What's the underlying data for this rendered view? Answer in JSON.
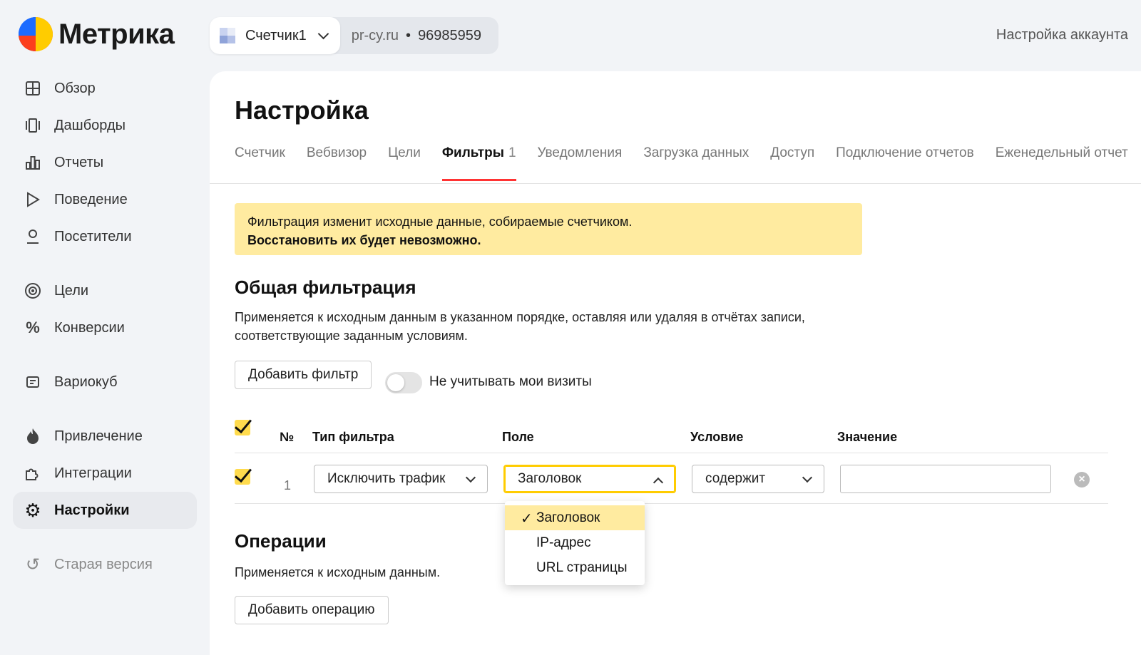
{
  "app": {
    "logo_text": "Метрика",
    "account_link": "Настройка аккаунта"
  },
  "counter": {
    "name": "Счетчик1",
    "site": "pr-cy.ru",
    "separator": "•",
    "id": "96985959"
  },
  "sidebar": {
    "items": [
      {
        "label": "Обзор",
        "icon": "grid-icon"
      },
      {
        "label": "Дашборды",
        "icon": "dashboards-icon"
      },
      {
        "label": "Отчеты",
        "icon": "reports-icon"
      },
      {
        "label": "Поведение",
        "icon": "play-icon"
      },
      {
        "label": "Посетители",
        "icon": "user-icon"
      },
      {
        "label": "Цели",
        "icon": "target-icon"
      },
      {
        "label": "Конверсии",
        "icon": "percent-icon"
      },
      {
        "label": "Вариокуб",
        "icon": "variocube-icon"
      },
      {
        "label": "Привлечение",
        "icon": "flame-icon"
      },
      {
        "label": "Интеграции",
        "icon": "puzzle-icon"
      },
      {
        "label": "Настройки",
        "icon": "gear-icon"
      },
      {
        "label": "Старая версия",
        "icon": "undo-icon"
      }
    ],
    "active": "Настройки"
  },
  "page": {
    "title": "Настройка",
    "tabs": [
      {
        "label": "Счетчик"
      },
      {
        "label": "Вебвизор"
      },
      {
        "label": "Цели"
      },
      {
        "label": "Фильтры",
        "badge": "1"
      },
      {
        "label": "Уведомления"
      },
      {
        "label": "Загрузка данных"
      },
      {
        "label": "Доступ"
      },
      {
        "label": "Подключение отчетов"
      },
      {
        "label": "Еженедельный отчет"
      }
    ],
    "active_tab": "Фильтры"
  },
  "warning": {
    "line1": "Фильтрация изменит исходные данные, собираемые счетчиком.",
    "line2": "Восстановить их будет невозможно."
  },
  "filtering": {
    "title": "Общая фильтрация",
    "description_line1": "Применяется к исходным данным в указанном порядке, оставляя или удаляя в отчётах записи,",
    "description_line2": "соответствующие заданным условиям.",
    "add_button": "Добавить фильтр",
    "toggle_label": "Не учитывать мои визиты",
    "toggle_on": false,
    "columns": [
      "№",
      "Тип фильтра",
      "Поле",
      "Условие",
      "Значение"
    ],
    "rows": [
      {
        "checked": true,
        "num": "1",
        "type": "Исключить трафик",
        "field": "Заголовок",
        "condition": "содержит",
        "value": ""
      }
    ],
    "field_dropdown": {
      "options": [
        "Заголовок",
        "IP-адрес",
        "URL страницы"
      ],
      "selected": "Заголовок",
      "check_glyph": "✓"
    }
  },
  "operations": {
    "title": "Операции",
    "description": "Применяется к исходным данным.",
    "add_button": "Добавить операцию"
  },
  "colors": {
    "accent_yellow": "#ffdb4d",
    "warning_bg": "#ffeba0",
    "tab_underline": "#ff3333",
    "focus_border": "#ffcc00"
  }
}
